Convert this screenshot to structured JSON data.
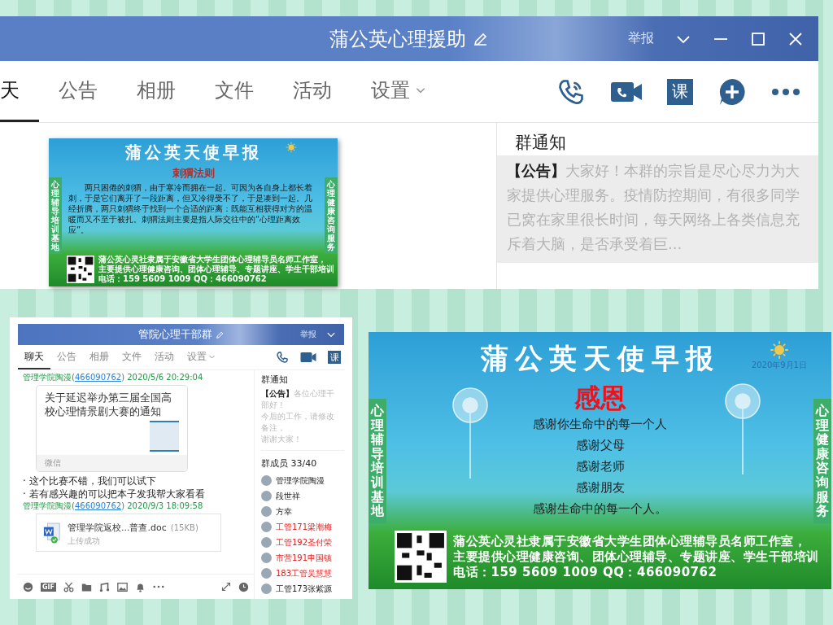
{
  "main_window": {
    "title": "蒲公英心理援助",
    "report": "举报",
    "tabs": [
      {
        "label": "天",
        "selected": true,
        "has_menu": false
      },
      {
        "label": "公告",
        "selected": false,
        "has_menu": false
      },
      {
        "label": "相册",
        "selected": false,
        "has_menu": false
      },
      {
        "label": "文件",
        "selected": false,
        "has_menu": false
      },
      {
        "label": "活动",
        "selected": false,
        "has_menu": false
      },
      {
        "label": "设置",
        "selected": false,
        "has_menu": true
      }
    ],
    "course_label": "课",
    "poster": {
      "kind": "compact",
      "title": "蒲公英天使早报",
      "heading": "刺猬法则",
      "body": [
        "两只困倦的刺猬，由于寒冷而拥在一起。可因为各自身上都长着刺，于是它们离开了一段距离，但又冷得受不了，于是凑到一起。几经折腾，两只刺猬终于找到一个合适的距离：既能互相获得对方的温暖而又不至于被扎。刺猬法则主要是指人际交往中的“心理距离效应”。"
      ],
      "left_banner": "心理辅导培训基地",
      "right_banner": "心理健康咨询服务",
      "footer": [
        "蒲公英心灵社隶属于安徽省大学生团体心理辅导员名师工作室，",
        "主要提供心理健康咨询、团体心理辅导、专题讲座、学生干部培训",
        "电话：159 5609 1009  QQ：466090762"
      ]
    },
    "notice": {
      "heading": "群通知",
      "tag": "【公告】",
      "body": "大家好！本群的宗旨是尽心尽力为大家提供心理服务。疫情防控期间，有很多同学已窝在家里很长时间，每天网络上各类信息充斥着大脑，是否承受着巨..."
    }
  },
  "small_window": {
    "title": "管院心理干部群",
    "report": "举报",
    "tabs": [
      {
        "label": "聊天",
        "selected": true,
        "has_menu": false
      },
      {
        "label": "公告",
        "selected": false,
        "has_menu": false
      },
      {
        "label": "相册",
        "selected": false,
        "has_menu": false
      },
      {
        "label": "文件",
        "selected": false,
        "has_menu": false
      },
      {
        "label": "活动",
        "selected": false,
        "has_menu": false
      },
      {
        "label": "设置",
        "selected": false,
        "has_menu": true
      }
    ],
    "course_label": "课",
    "messages": [
      {
        "kind": "sender",
        "name": "管理学院陶漫(",
        "qq": "466090762",
        "time": ") 2020/5/6 20:29:04"
      },
      {
        "kind": "card",
        "title": "关于延迟举办第三届全国高校心理情景剧大赛的通知",
        "source": "微信"
      },
      {
        "kind": "text",
        "text": "· 这个比赛不错，我们可以试下"
      },
      {
        "kind": "text",
        "text": "· 若有感兴趣的可以把本子发我帮大家看看"
      },
      {
        "kind": "sender",
        "name": "管理学院陶漫(",
        "qq": "466090762",
        "time": ") 2020/9/3 18:09:58"
      },
      {
        "kind": "file",
        "name": "管理学院返校...普查.doc",
        "size": "(15KB)",
        "status": "上传成功"
      }
    ],
    "toolbar_gif": "GIF",
    "notice": {
      "heading": "群通知",
      "tag": "【公告】",
      "lines": [
        "各位心理干部好！",
        "今后的工作，请修改备注，",
        "谢谢大家！"
      ]
    },
    "members_heading": "群成员 33/40",
    "members": [
      {
        "name": "管理学院陶漫",
        "highlighted": false
      },
      {
        "name": "段世祥",
        "highlighted": false
      },
      {
        "name": "方幸",
        "highlighted": false
      },
      {
        "name": "工管171梁潮梅",
        "highlighted": true
      },
      {
        "name": "工管192圣付荣",
        "highlighted": true
      },
      {
        "name": "市营191申国镇",
        "highlighted": true
      },
      {
        "name": "183工管吴慧慧",
        "highlighted": true
      },
      {
        "name": "工管173张紫源",
        "highlighted": false
      }
    ]
  },
  "poster_large": {
    "kind": "large",
    "title": "蒲公英天使早报",
    "date": "2020年9月1日",
    "heading": "感恩",
    "body": [
      "感谢你生命中的每一个人",
      "感谢父母",
      "感谢老师",
      "感谢朋友",
      "感谢生命中的每一个人。"
    ],
    "left_banner": "心理辅导培训基地",
    "right_banner": "心理健康咨询服务",
    "footer": [
      "蒲公英心灵社隶属于安徽省大学生团体心理辅导员名师工作室，",
      "主要提供心理健康咨询、团体心理辅导、专题讲座、学生干部培训",
      "电话：159 5609 1009  QQ：466090762"
    ]
  }
}
